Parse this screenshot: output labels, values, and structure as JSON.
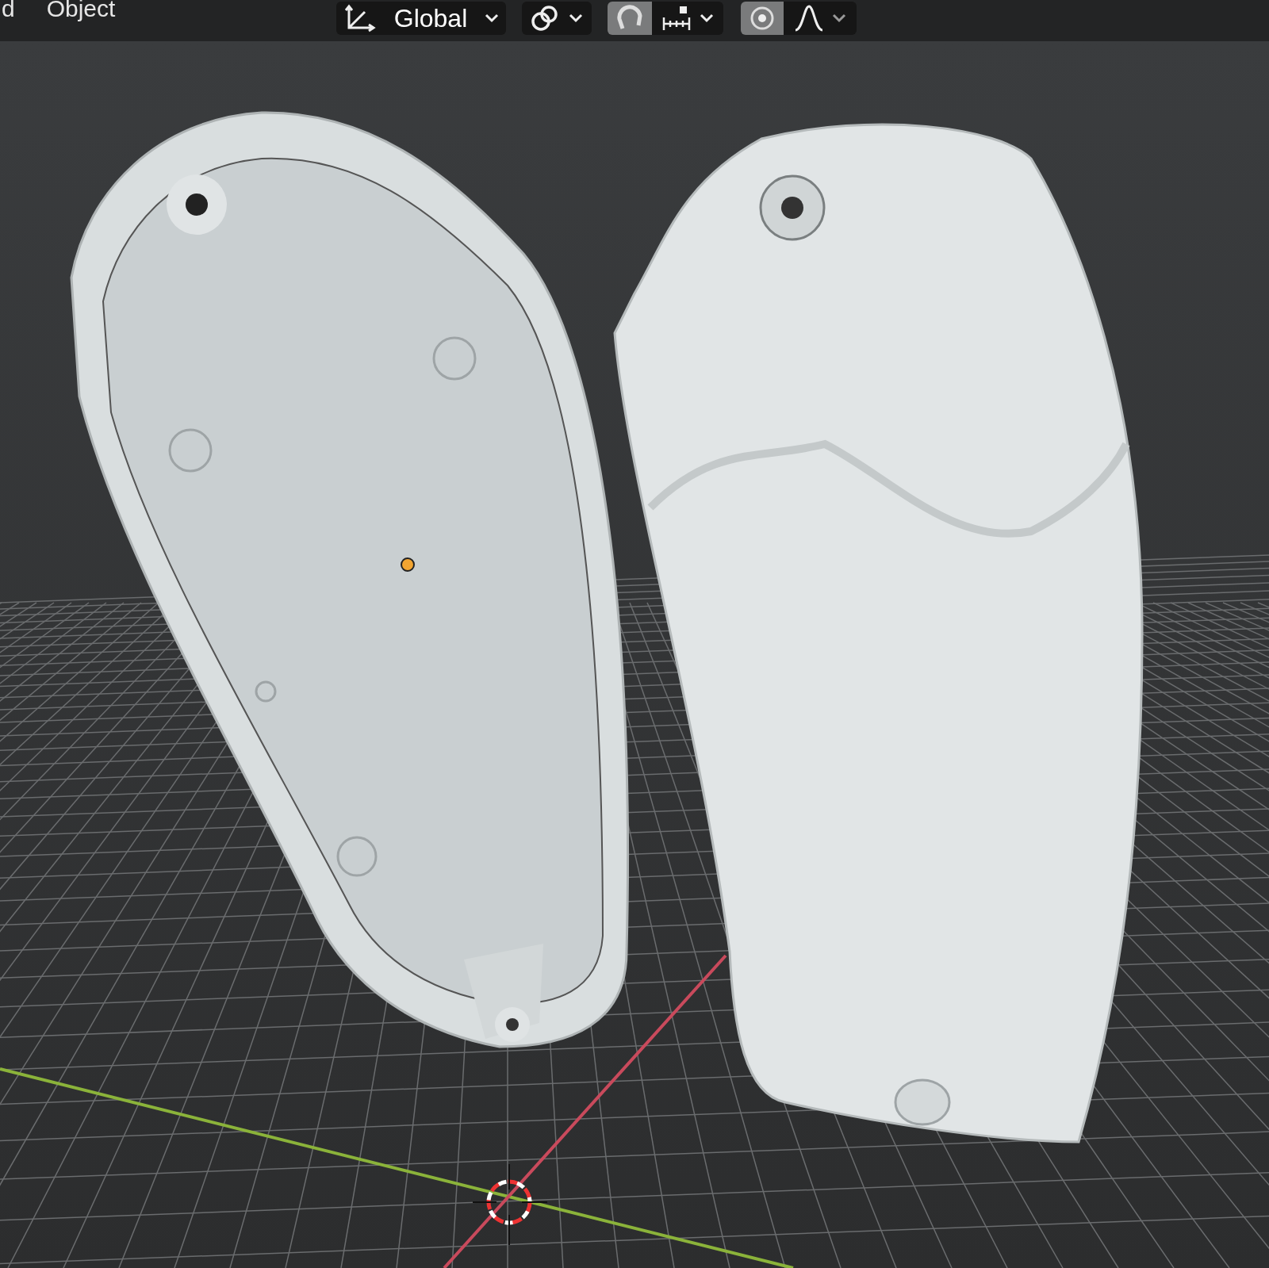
{
  "header": {
    "menus": [
      {
        "label": "d"
      },
      {
        "label": "Object"
      }
    ],
    "orientation": {
      "label": "Global"
    },
    "snap": {
      "on": true
    },
    "proportional_editing": {
      "on": true
    }
  }
}
